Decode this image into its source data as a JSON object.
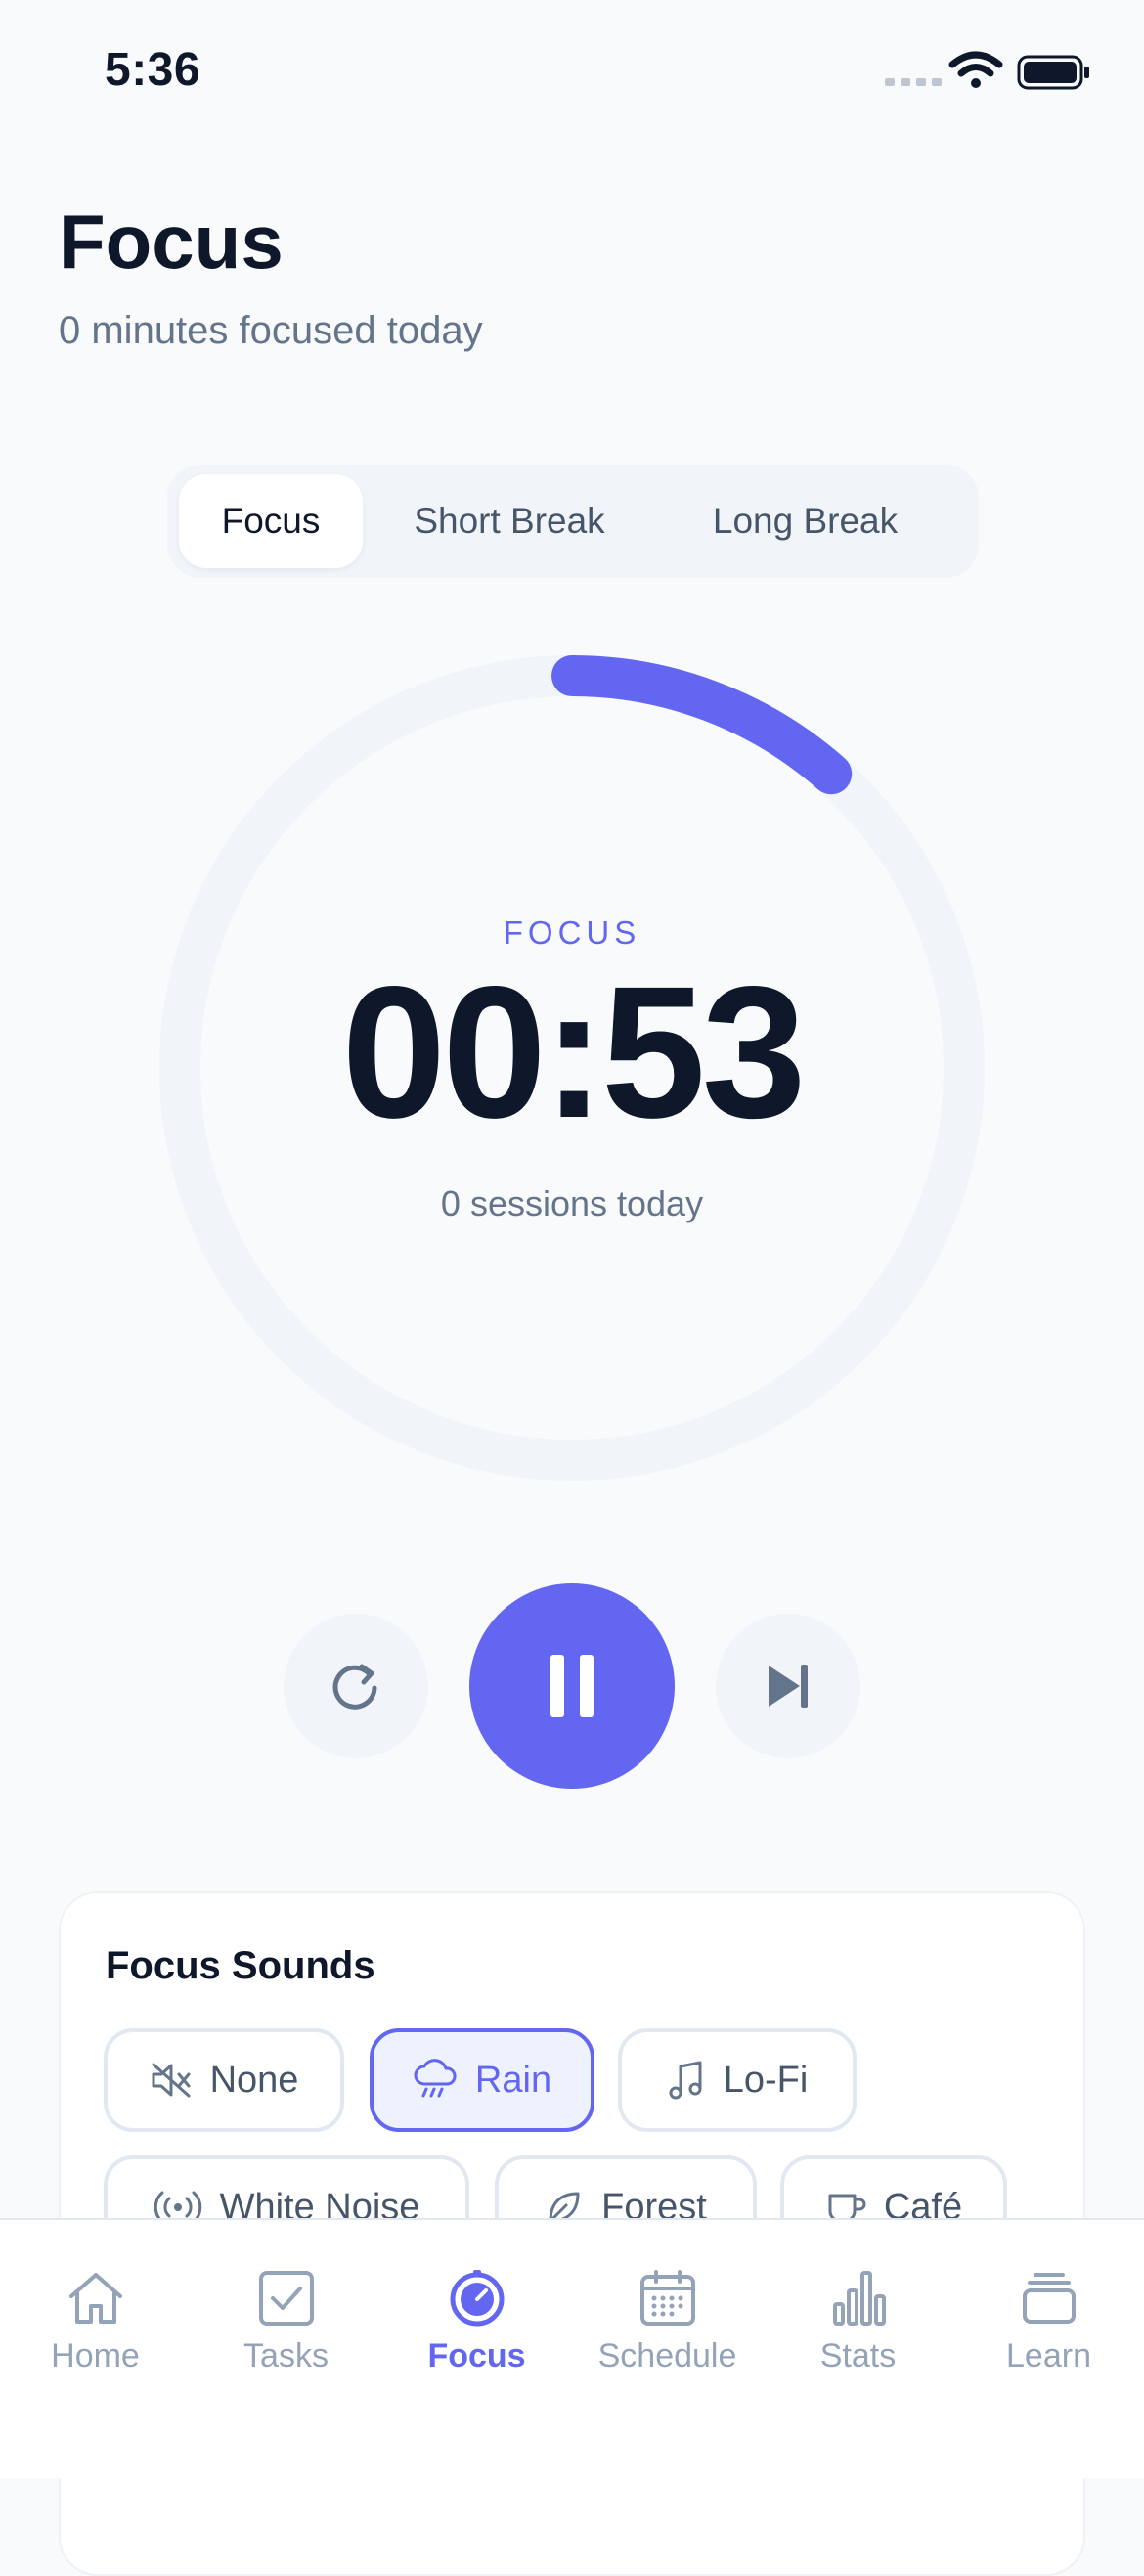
{
  "status_bar": {
    "time": "5:36"
  },
  "header": {
    "title": "Focus",
    "subtitle": "0 minutes focused today"
  },
  "mode_tabs": [
    {
      "label": "Focus",
      "active": true
    },
    {
      "label": "Short Break",
      "active": false
    },
    {
      "label": "Long Break",
      "active": false
    }
  ],
  "timer": {
    "label": "FOCUS",
    "time": "00:53",
    "sessions": "0 sessions today",
    "progress": 0.115
  },
  "controls": {
    "reset_icon": "reset-icon",
    "pause_icon": "pause-icon",
    "skip_icon": "skip-icon"
  },
  "sounds": {
    "title": "Focus Sounds",
    "options": [
      {
        "label": "None",
        "icon": "mute-icon",
        "active": false
      },
      {
        "label": "Rain",
        "icon": "rain-icon",
        "active": true
      },
      {
        "label": "Lo-Fi",
        "icon": "music-icon",
        "active": false
      },
      {
        "label": "White Noise",
        "icon": "broadcast-icon",
        "active": false
      },
      {
        "label": "Forest",
        "icon": "leaf-icon",
        "active": false
      },
      {
        "label": "Café",
        "icon": "cup-icon",
        "active": false
      }
    ]
  },
  "tabbar": [
    {
      "label": "Home",
      "icon": "home-icon",
      "active": false
    },
    {
      "label": "Tasks",
      "icon": "tasks-icon",
      "active": false
    },
    {
      "label": "Focus",
      "icon": "focus-icon",
      "active": true
    },
    {
      "label": "Schedule",
      "icon": "calendar-icon",
      "active": false
    },
    {
      "label": "Stats",
      "icon": "stats-icon",
      "active": false
    },
    {
      "label": "Learn",
      "icon": "learn-icon",
      "active": false
    }
  ],
  "colors": {
    "accent": "#6366F1",
    "text": "#0F172A",
    "muted": "#64748B",
    "track": "#F1F5F9"
  }
}
